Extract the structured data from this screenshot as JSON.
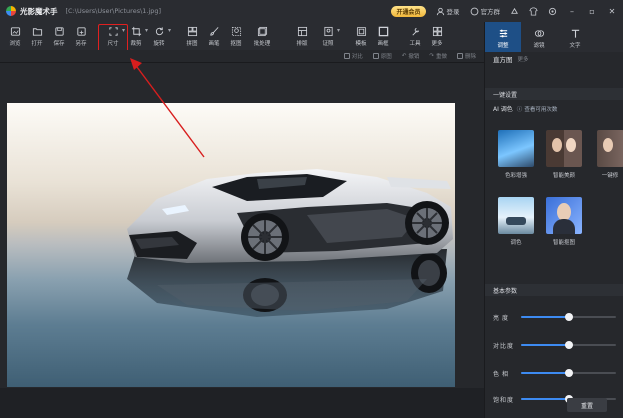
{
  "titlebar": {
    "app_name": "光影魔术手",
    "file_path": "[C:\\Users\\User\\Pictures\\1.jpg]",
    "vip_label": "开通会员",
    "login_label": "登录",
    "official_label": "官方群"
  },
  "toolbar": {
    "items": [
      {
        "label": "浏览",
        "icon": "browse-icon"
      },
      {
        "label": "打开",
        "icon": "folder-icon"
      },
      {
        "label": "保存",
        "icon": "save-icon"
      },
      {
        "label": "另存",
        "icon": "save-as-icon"
      },
      {
        "label": "尺寸",
        "icon": "resize-icon"
      },
      {
        "label": "裁剪",
        "icon": "crop-icon"
      },
      {
        "label": "旋转",
        "icon": "rotate-icon"
      },
      {
        "label": "拼图",
        "icon": "collage-icon"
      },
      {
        "label": "画笔",
        "icon": "brush-icon"
      },
      {
        "label": "抠图",
        "icon": "cutout-icon"
      },
      {
        "label": "批处理",
        "icon": "batch-icon"
      },
      {
        "label": "排版",
        "icon": "layout-icon"
      },
      {
        "label": "证照",
        "icon": "id-photo-icon"
      },
      {
        "label": "模板",
        "icon": "template-icon"
      },
      {
        "label": "画框",
        "icon": "frame-icon"
      },
      {
        "label": "工具",
        "icon": "tools-icon"
      },
      {
        "label": "更多",
        "icon": "more-icon"
      }
    ]
  },
  "subbar": {
    "items": [
      "对比",
      "原图",
      "撤销",
      "重做",
      "删除"
    ]
  },
  "right_panel": {
    "tabs": [
      {
        "label": "调整",
        "icon": "adjust-icon"
      },
      {
        "label": "滤镜",
        "icon": "filter-icon"
      },
      {
        "label": "文字",
        "icon": "text-icon"
      }
    ],
    "histogram_label": "直方图",
    "histogram_sub": "更多",
    "oneclick_label": "一键设置",
    "ai_label": "AI 调色",
    "ai_link": "查看可用次数",
    "presets": [
      {
        "label": "色彩增强"
      },
      {
        "label": "智能美颜"
      },
      {
        "label": "一键修"
      },
      {
        "label": "调色"
      },
      {
        "label": "智能抠图"
      }
    ],
    "basic_label": "基本参数",
    "sliders": [
      {
        "label": "亮度",
        "value": 0.5
      },
      {
        "label": "对比度",
        "value": 0.5
      },
      {
        "label": "色相",
        "value": 0.5
      },
      {
        "label": "饱和度",
        "value": 0.5
      }
    ],
    "reset_label": "重置"
  },
  "colors": {
    "accent": "#3d8bf2",
    "highlight": "#e02020",
    "active_tab": "#1e4f86"
  }
}
